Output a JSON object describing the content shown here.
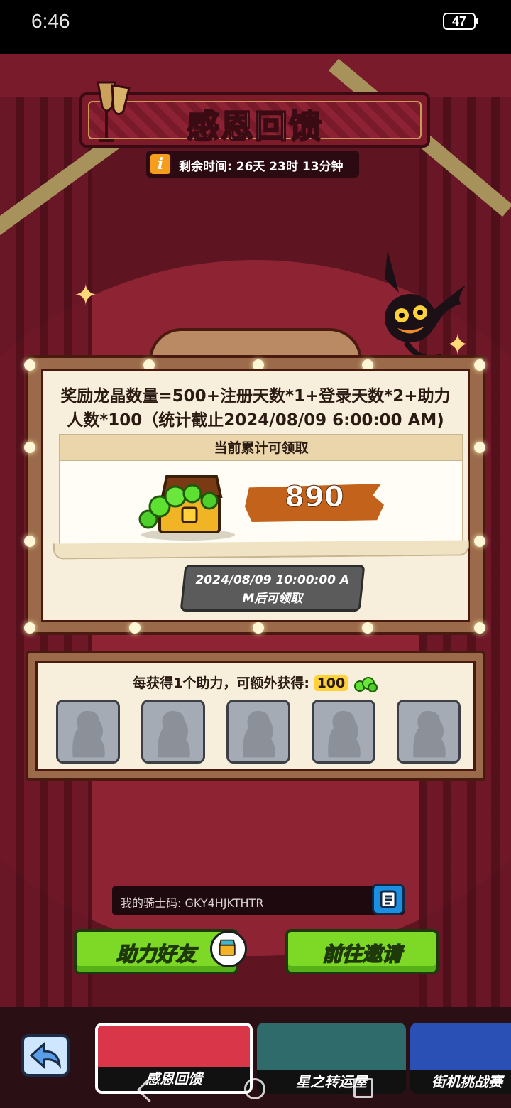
{
  "status": {
    "time": "6:46",
    "battery": "47"
  },
  "event": {
    "title": "感恩回馈",
    "timer_label": "剩余时间:",
    "timer_value": "26天 23时 13分钟",
    "formula_line1": "奖励龙晶数量=500+注册天数*1+登录天数*2+助力",
    "formula_line2": "人数*100（统计截止2024/08/09 6:00:00 AM)",
    "claim_header": "当前累计可领取",
    "amount": "890",
    "locked_line1": "2024/08/09 10:00:00 A",
    "locked_line2": "M后可领取"
  },
  "helpers": {
    "title_prefix": "每获得1个助力，可额外获得:",
    "bonus": "100",
    "slot_count": 5
  },
  "knight_code": {
    "label": "我的骑士码: GKY4HJKTHTR"
  },
  "actions": {
    "help_friend": "助力好友",
    "go_invite": "前往邀请"
  },
  "nav": {
    "cards": [
      {
        "label": "感恩回馈"
      },
      {
        "label": "星之转运屋"
      },
      {
        "label": "街机挑战赛"
      }
    ]
  },
  "colors": {
    "accent_green": "#7ed926",
    "amount_orange": "#c2621b",
    "curtain_red": "#8e2333"
  }
}
